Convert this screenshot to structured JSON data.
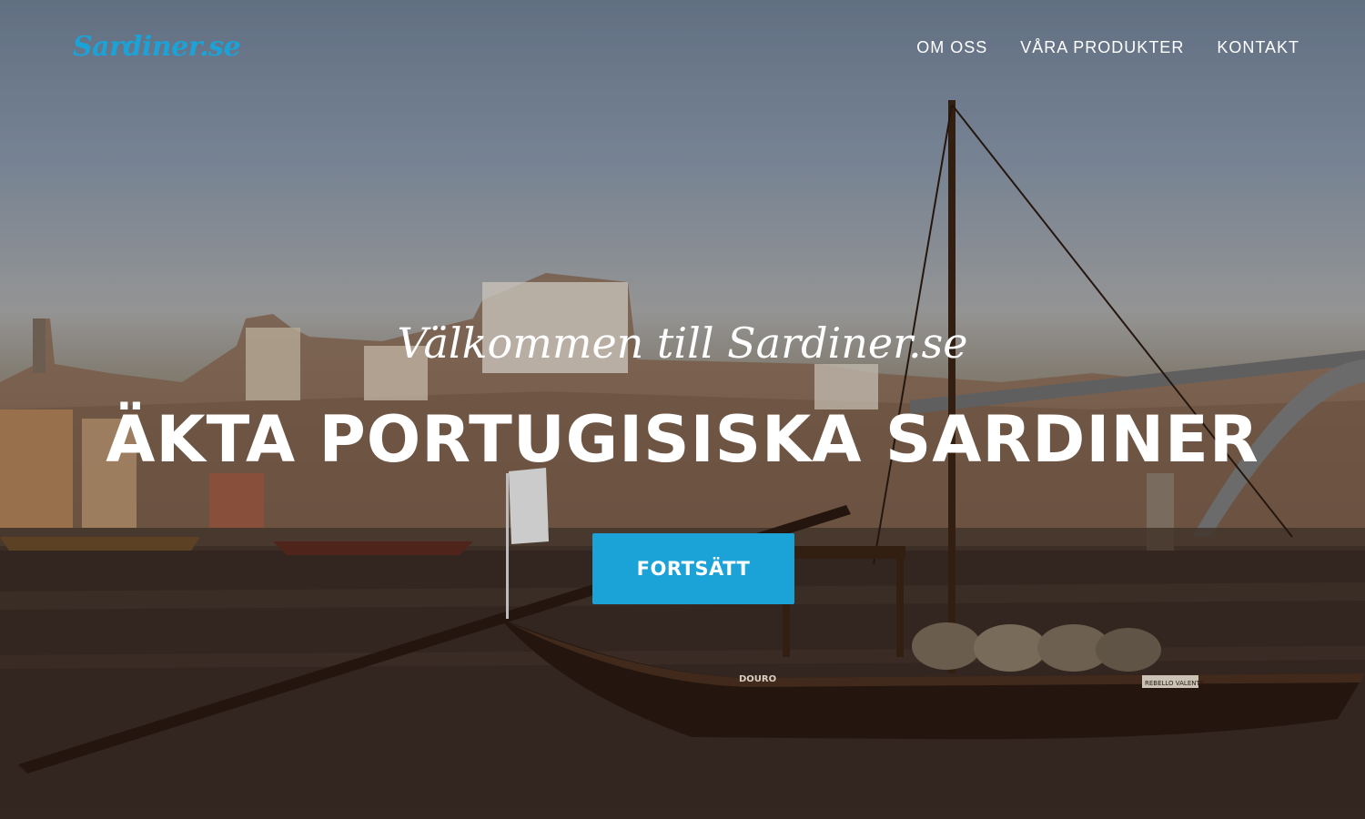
{
  "header": {
    "logo": "Sardiner.se",
    "nav": [
      {
        "label": "OM OSS"
      },
      {
        "label": "VÅRA PRODUKTER"
      },
      {
        "label": "KONTAKT"
      }
    ]
  },
  "hero": {
    "welcome": "Välkommen till Sardiner.se",
    "headline": "ÄKTA PORTUGISISKA SARDINER",
    "button_label": "FORTSÄTT",
    "boat_name": "DOURO",
    "boat_plate": "REBELLO VALENTE"
  },
  "colors": {
    "accent": "#1ba2d6",
    "text": "#ffffff"
  }
}
